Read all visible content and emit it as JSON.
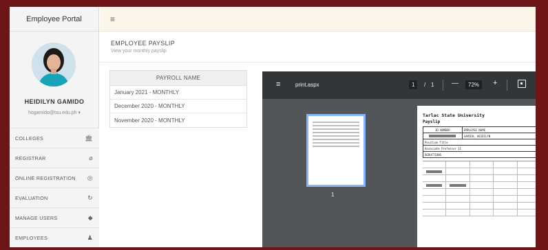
{
  "app": {
    "brand": "Employee Portal",
    "menu_icon": "hamburger-icon"
  },
  "user": {
    "name": "HEIDILYN GAMIDO",
    "email": "hogamido@tsu.edu.ph"
  },
  "nav": [
    {
      "label": "COLLEGES",
      "icon": "bank-icon"
    },
    {
      "label": "REGISTRAR",
      "icon": "paperclip-icon"
    },
    {
      "label": "ONLINE REGISTRATION",
      "icon": "registration-icon"
    },
    {
      "label": "EVALUATION",
      "icon": "refresh-icon"
    },
    {
      "label": "MANAGE USERS",
      "icon": "tag-icon"
    },
    {
      "label": "EMPLOYEES",
      "icon": "user-icon"
    }
  ],
  "page": {
    "title": "EMPLOYEE PAYSLIP",
    "subtitle": "View your monthly payslip"
  },
  "payroll_table": {
    "header": "PAYROLL NAME",
    "rows": [
      "January 2021 - MONTHLY",
      "December 2020 - MONTHLY",
      "November 2020 - MONTHLY"
    ]
  },
  "pdf_viewer": {
    "filename": "print.aspx",
    "current_page": "1",
    "total_pages": "1",
    "zoom": "72%",
    "thumbnail_label": "1",
    "document": {
      "org": "Tarlac State University",
      "doc_title": "Payslip",
      "header_cells": [
        "ID NUMBER",
        "EMPLOYEE NAME"
      ],
      "employee_name": "GAMIDO, HEIDILYN",
      "position_label": "Position Title",
      "position_value": "Associate Professor II",
      "deductions_label": "DEDUCTIONS"
    }
  },
  "colors": {
    "frame": "#6e1518",
    "topbar": "#fbf6e9",
    "viewer_toolbar": "#323639",
    "viewer_bg": "#525659",
    "thumb_highlight": "#8ab4f8"
  }
}
